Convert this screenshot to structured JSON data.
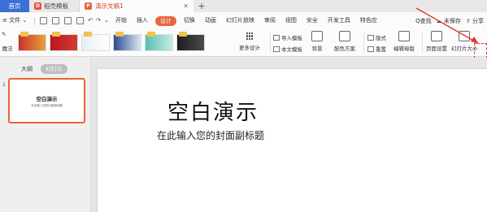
{
  "tabs": {
    "home": "首页",
    "template": "稻壳模板",
    "document": "演示文稿1",
    "new": "+"
  },
  "menu": {
    "hamburger": "≡",
    "file": "文件",
    "items": [
      "开始",
      "插入",
      "设计",
      "切换",
      "动画",
      "幻灯片放映",
      "审阅",
      "视图",
      "安全",
      "开发工具",
      "特色应"
    ],
    "active_item": "设计",
    "search": "Q查找",
    "save_status": "未保存",
    "share": "分享"
  },
  "ribbon": {
    "magic": "魔法",
    "more_designs": "更多设计",
    "import_template": "导入模板",
    "background": "背景",
    "text_template": "本文模板",
    "color_scheme": "配色方案",
    "layout": "版式",
    "rearrange": "重置",
    "edit_master": "编辑母版",
    "page_setup": "页面设置",
    "slide_size": "幻灯片大小"
  },
  "panel": {
    "outline_tab": "大纲",
    "slides_tab": "幻灯片",
    "slide_number": "1",
    "thumb_title": "空白演示",
    "thumb_subtitle": "在此输入您的封面副标题"
  },
  "slide": {
    "title": "空白演示",
    "subtitle": "在此输入您的封面副标题"
  },
  "colors": {
    "accent": "#e8643a",
    "home_tab": "#3b6fd6",
    "annotation": "#e0382b"
  }
}
